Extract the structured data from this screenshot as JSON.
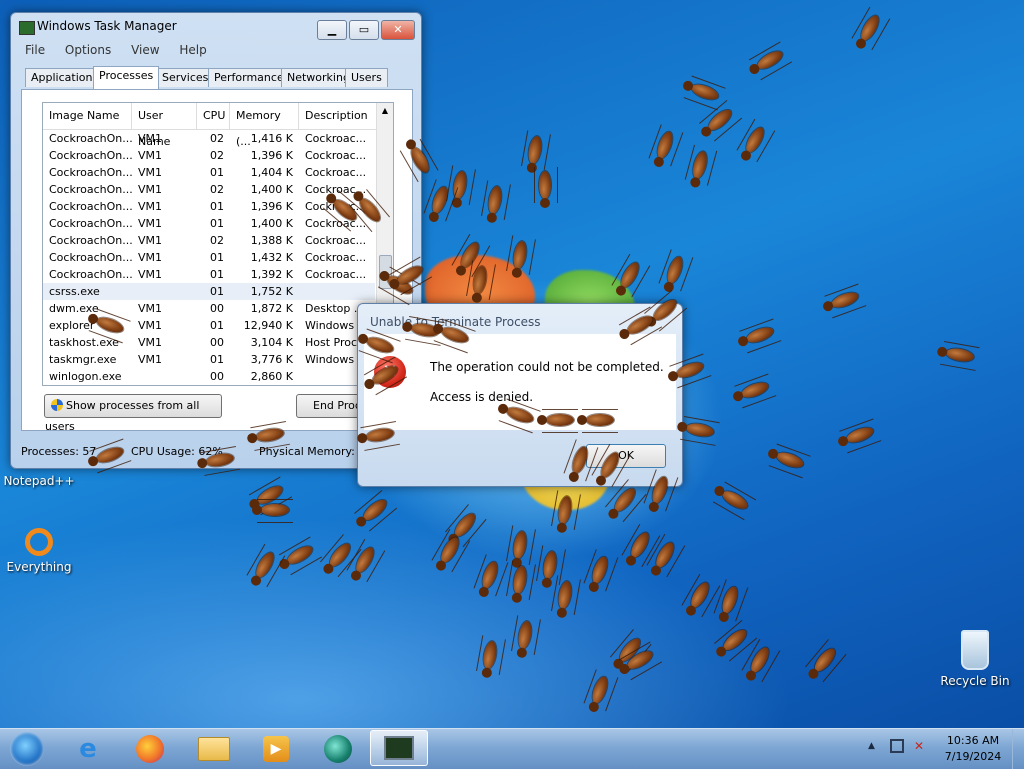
{
  "task_manager": {
    "title": "Windows Task Manager",
    "menu": [
      "File",
      "Options",
      "View",
      "Help"
    ],
    "tabs": [
      "Applications",
      "Processes",
      "Services",
      "Performance",
      "Networking",
      "Users"
    ],
    "active_tab": "Processes",
    "columns": [
      "Image Name",
      "User Name",
      "CPU",
      "Memory (...",
      "Description"
    ],
    "rows": [
      {
        "name": "CockroachOn...",
        "user": "VM1",
        "cpu": "02",
        "mem": "1,416 K",
        "desc": "Cockroac..."
      },
      {
        "name": "CockroachOn...",
        "user": "VM1",
        "cpu": "02",
        "mem": "1,396 K",
        "desc": "Cockroac..."
      },
      {
        "name": "CockroachOn...",
        "user": "VM1",
        "cpu": "01",
        "mem": "1,404 K",
        "desc": "Cockroac..."
      },
      {
        "name": "CockroachOn...",
        "user": "VM1",
        "cpu": "02",
        "mem": "1,400 K",
        "desc": "Cockroac..."
      },
      {
        "name": "CockroachOn...",
        "user": "VM1",
        "cpu": "01",
        "mem": "1,396 K",
        "desc": "Cockroac..."
      },
      {
        "name": "CockroachOn...",
        "user": "VM1",
        "cpu": "01",
        "mem": "1,400 K",
        "desc": "Cockroac..."
      },
      {
        "name": "CockroachOn...",
        "user": "VM1",
        "cpu": "02",
        "mem": "1,388 K",
        "desc": "Cockroac..."
      },
      {
        "name": "CockroachOn...",
        "user": "VM1",
        "cpu": "01",
        "mem": "1,432 K",
        "desc": "Cockroac..."
      },
      {
        "name": "CockroachOn...",
        "user": "VM1",
        "cpu": "01",
        "mem": "1,392 K",
        "desc": "Cockroac..."
      },
      {
        "name": "csrss.exe",
        "user": "",
        "cpu": "01",
        "mem": "1,752 K",
        "desc": ""
      },
      {
        "name": "dwm.exe",
        "user": "VM1",
        "cpu": "00",
        "mem": "1,872 K",
        "desc": "Desktop ..."
      },
      {
        "name": "explorer",
        "user": "VM1",
        "cpu": "01",
        "mem": "12,940 K",
        "desc": "Windows ..."
      },
      {
        "name": "taskhost.exe",
        "user": "VM1",
        "cpu": "00",
        "mem": "3,104 K",
        "desc": "Host Proc..."
      },
      {
        "name": "taskmgr.exe",
        "user": "VM1",
        "cpu": "01",
        "mem": "3,776 K",
        "desc": "Windows ..."
      },
      {
        "name": "winlogon.exe",
        "user": "",
        "cpu": "00",
        "mem": "2,860 K",
        "desc": ""
      }
    ],
    "show_all_button": "Show processes from all users",
    "end_process_button": "End Process",
    "status_processes": "Processes: 57",
    "status_cpu": "CPU Usage: 62%",
    "status_memory": "Physical Memory: 2"
  },
  "dialog": {
    "title": "Unable to Terminate Process",
    "message": "The operation could not be completed.",
    "detail": "Access is denied.",
    "ok_button": "OK"
  },
  "desktop_icons": [
    {
      "label": "Notepad++",
      "icon": "notepad-plus-plus-icon"
    },
    {
      "label": "Everything",
      "icon": "everything-search-icon"
    },
    {
      "label": "Recycle Bin",
      "icon": "recycle-bin-icon"
    }
  ],
  "taskbar": {
    "pinned": [
      "start-orb-icon",
      "internet-explorer-icon",
      "firefox-icon",
      "file-explorer-icon",
      "media-player-icon",
      "app-icon",
      "task-manager-icon"
    ],
    "clock_time": "10:36 AM",
    "clock_date": "7/19/2024"
  },
  "colors": {
    "desktop_blue": "#1a86d8",
    "window_frame": "#b9d1ec",
    "selection": "#e8eef7",
    "error_red": "#d42a1c"
  }
}
